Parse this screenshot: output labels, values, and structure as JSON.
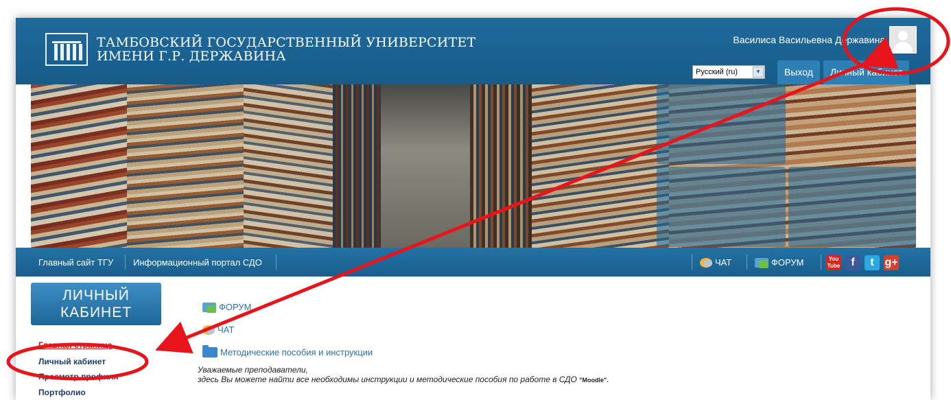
{
  "header": {
    "university_line1": "ТАМБОВСКИЙ ГОСУДАРСТВЕННЫЙ УНИВЕРСИТЕТ",
    "university_line2": "ИМЕНИ Г.Р. ДЕРЖАВИНА",
    "user_name": "Василиса Васильевна Державина",
    "language_selected": "Русский (ru)",
    "logout_label": "Выход",
    "cabinet_label": "Личный кабинет"
  },
  "navbar": {
    "main_site": "Главный сайт ТГУ",
    "portal": "Информационный портал СДО",
    "chat": "ЧАТ",
    "forum": "ФОРУМ",
    "youtube": "You Tube",
    "facebook": "f",
    "twitter": "t",
    "gplus": "g+"
  },
  "sidebar": {
    "block_title_line1": "ЛИЧНЫЙ",
    "block_title_line2": "КАБИНЕТ",
    "items": [
      "Главная страница",
      "Личный кабинет",
      "Просмотр профиля",
      "Портфолио"
    ]
  },
  "main": {
    "forum_link": "ФОРУМ",
    "chat_link": "ЧАТ",
    "methods_link": "Методические пособия и инструкции",
    "notice_line1": "Уважаемые преподаватели,",
    "notice_line2": "здесь Вы можете найти все необходимы инструкции и методические пособия по работе в СДО",
    "notice_moodle": "\"Moodle\"."
  },
  "colors": {
    "header_blue": "#1f6a9c",
    "accent_red": "#e8141c",
    "link_blue": "#2c6fb0"
  }
}
